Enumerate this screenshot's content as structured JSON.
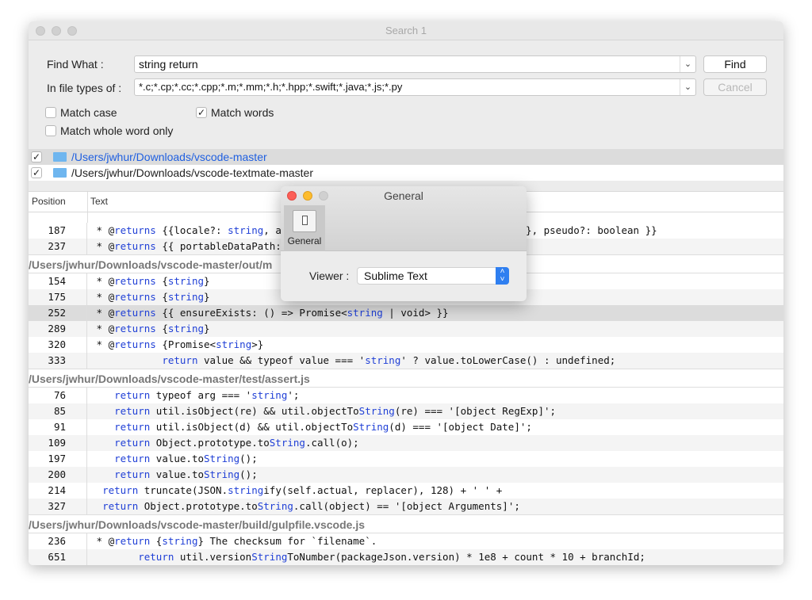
{
  "window": {
    "title": "Search 1"
  },
  "form": {
    "find_label": "Find What :",
    "find_value": "string return",
    "types_label": "In file types of :",
    "types_value": "*.c;*.cp;*.cc;*.cpp;*.m;*.mm;*.h;*.hpp;*.swift;*.java;*.js;*.py",
    "find_button": "Find",
    "cancel_button": "Cancel",
    "match_case": "Match case",
    "match_words": "Match words",
    "match_whole": "Match whole word only",
    "match_case_checked": false,
    "match_words_checked": true,
    "match_whole_checked": false
  },
  "folders": [
    {
      "path": "/Users/jwhur/Downloads/vscode-master",
      "checked": true
    },
    {
      "path": "/Users/jwhur/Downloads/vscode-textmate-master",
      "checked": true
    }
  ],
  "columns": {
    "position": "Position",
    "text": "Text"
  },
  "groups": [
    {
      "file": null,
      "rows": [
        {
          "pos": "187",
          "parts": [
            [
              " * @",
              0
            ],
            [
              "returns",
              1
            ],
            [
              " {{locale?: ",
              0
            ],
            [
              "string",
              1
            ],
            [
              ", a",
              0
            ]
          ],
          "tail": [
            [
              "g",
              1
            ],
            [
              ";}, pseudo?: boolean }}",
              0
            ]
          ]
        },
        {
          "pos": "237",
          "parts": [
            [
              " * @",
              0
            ],
            [
              "returns",
              1
            ],
            [
              " {{ portableDataPath:",
              0
            ]
          ]
        }
      ]
    },
    {
      "file": "/Users/jwhur/Downloads/vscode-master/out/m",
      "rows": [
        {
          "pos": "154",
          "parts": [
            [
              " * @",
              0
            ],
            [
              "returns",
              1
            ],
            [
              " {",
              0
            ],
            [
              "string",
              1
            ],
            [
              "}",
              0
            ]
          ]
        },
        {
          "pos": "175",
          "parts": [
            [
              " * @",
              0
            ],
            [
              "returns",
              1
            ],
            [
              " {",
              0
            ],
            [
              "string",
              1
            ],
            [
              "}",
              0
            ]
          ]
        },
        {
          "pos": "252",
          "sel": true,
          "parts": [
            [
              " * @",
              0
            ],
            [
              "returns",
              1
            ],
            [
              " {{ ensureExists: () => Promise<",
              0
            ],
            [
              "string",
              1
            ],
            [
              " | void> }}",
              0
            ]
          ]
        },
        {
          "pos": "289",
          "parts": [
            [
              " * @",
              0
            ],
            [
              "returns",
              1
            ],
            [
              " {",
              0
            ],
            [
              "string",
              1
            ],
            [
              "}",
              0
            ]
          ]
        },
        {
          "pos": "320",
          "parts": [
            [
              " * @",
              0
            ],
            [
              "returns",
              1
            ],
            [
              " {Promise<",
              0
            ],
            [
              "string",
              1
            ],
            [
              ">}",
              0
            ]
          ]
        },
        {
          "pos": "333",
          "parts": [
            [
              "            ",
              0
            ],
            [
              "return",
              1
            ],
            [
              " value && typeof value === '",
              0
            ],
            [
              "string",
              1
            ],
            [
              "' ? value.toLowerCase() : undefined;",
              0
            ]
          ]
        }
      ]
    },
    {
      "file": "/Users/jwhur/Downloads/vscode-master/test/assert.js",
      "rows": [
        {
          "pos": "76",
          "parts": [
            [
              "    ",
              0
            ],
            [
              "return",
              1
            ],
            [
              " typeof arg === '",
              0
            ],
            [
              "string",
              1
            ],
            [
              "';",
              0
            ]
          ]
        },
        {
          "pos": "85",
          "parts": [
            [
              "    ",
              0
            ],
            [
              "return",
              1
            ],
            [
              " util.isObject(re) && util.objectTo",
              0
            ],
            [
              "String",
              1
            ],
            [
              "(re) === '[object RegExp]';",
              0
            ]
          ]
        },
        {
          "pos": "91",
          "parts": [
            [
              "    ",
              0
            ],
            [
              "return",
              1
            ],
            [
              " util.isObject(d) && util.objectTo",
              0
            ],
            [
              "String",
              1
            ],
            [
              "(d) === '[object Date]';",
              0
            ]
          ]
        },
        {
          "pos": "109",
          "parts": [
            [
              "    ",
              0
            ],
            [
              "return",
              1
            ],
            [
              " Object.prototype.to",
              0
            ],
            [
              "String",
              1
            ],
            [
              ".call(o);",
              0
            ]
          ]
        },
        {
          "pos": "197",
          "parts": [
            [
              "    ",
              0
            ],
            [
              "return",
              1
            ],
            [
              " value.to",
              0
            ],
            [
              "String",
              1
            ],
            [
              "();",
              0
            ]
          ]
        },
        {
          "pos": "200",
          "parts": [
            [
              "    ",
              0
            ],
            [
              "return",
              1
            ],
            [
              " value.to",
              0
            ],
            [
              "String",
              1
            ],
            [
              "();",
              0
            ]
          ]
        },
        {
          "pos": "214",
          "parts": [
            [
              "  ",
              0
            ],
            [
              "return",
              1
            ],
            [
              " truncate(JSON.",
              0
            ],
            [
              "string",
              1
            ],
            [
              "ify(self.actual, replacer), 128) + ' ' +",
              0
            ]
          ]
        },
        {
          "pos": "327",
          "parts": [
            [
              "  ",
              0
            ],
            [
              "return",
              1
            ],
            [
              " Object.prototype.to",
              0
            ],
            [
              "String",
              1
            ],
            [
              ".call(object) == '[object Arguments]';",
              0
            ]
          ]
        }
      ]
    },
    {
      "file": "/Users/jwhur/Downloads/vscode-master/build/gulpfile.vscode.js",
      "rows": [
        {
          "pos": "236",
          "parts": [
            [
              " * @",
              0
            ],
            [
              "return",
              1
            ],
            [
              " {",
              0
            ],
            [
              "string",
              1
            ],
            [
              "} The checksum for `filename`.",
              0
            ]
          ]
        },
        {
          "pos": "651",
          "parts": [
            [
              "        ",
              0
            ],
            [
              "return",
              1
            ],
            [
              " util.version",
              0
            ],
            [
              "String",
              1
            ],
            [
              "ToNumber(packageJson.version) * 1e8 + count * 10 + branchId;",
              0
            ]
          ]
        }
      ]
    }
  ],
  "dialog": {
    "title": "General",
    "tab": "General",
    "viewer_label": "Viewer :",
    "viewer_value": "Sublime Text"
  },
  "colors": {
    "keyword": "#1f3fd6",
    "folder_selected": "#1f5fe0",
    "accent": "#2f7ff0"
  }
}
